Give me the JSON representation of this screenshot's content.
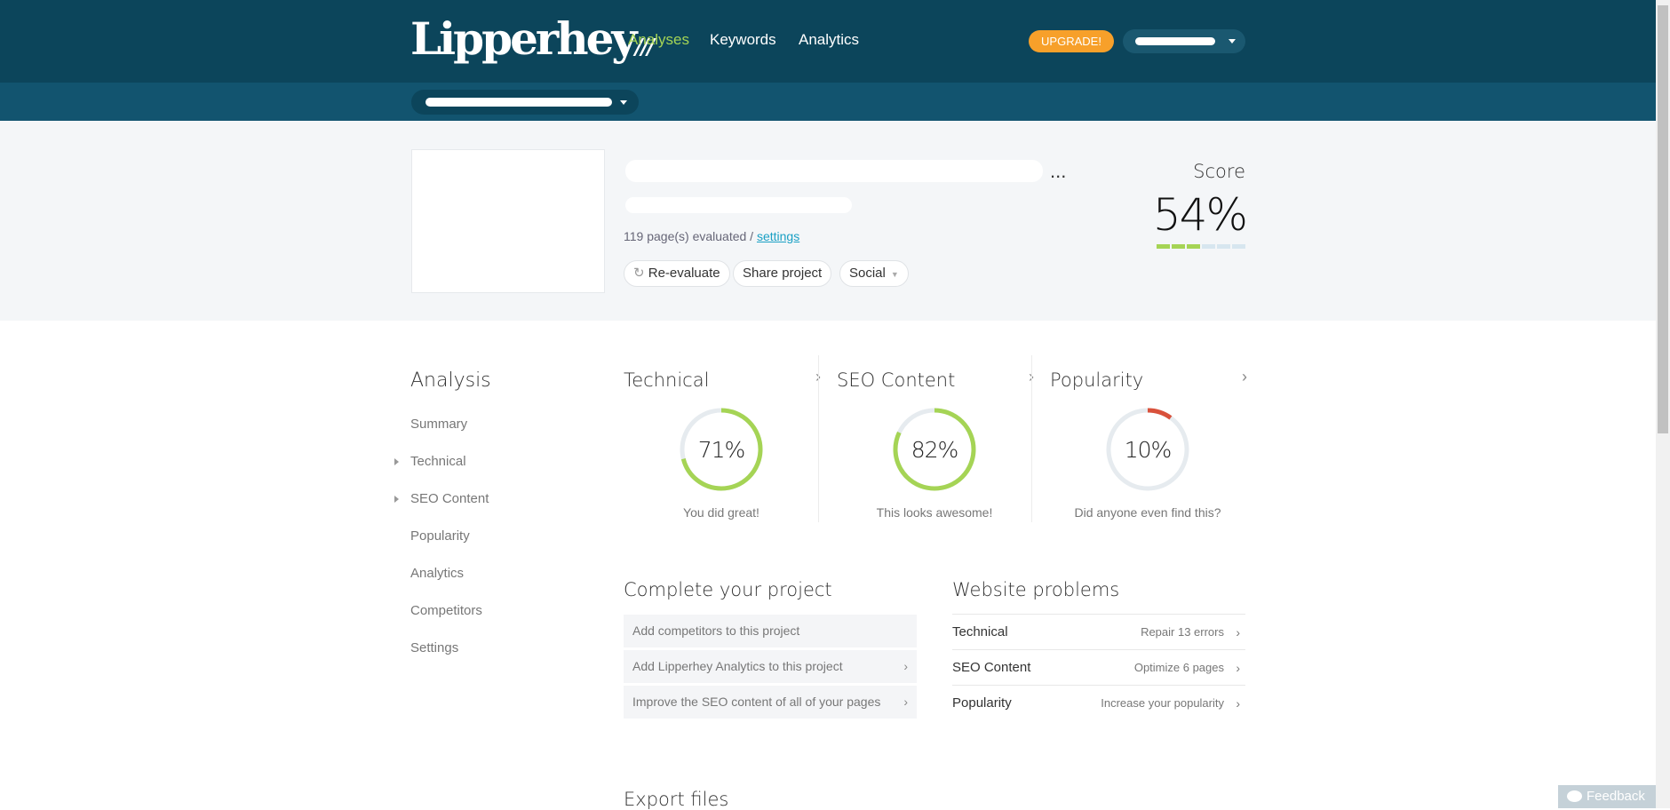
{
  "header": {
    "logo": "Lipperhey",
    "nav": [
      {
        "label": "Analyses",
        "active": true
      },
      {
        "label": "Keywords",
        "active": false
      },
      {
        "label": "Analytics",
        "active": false
      }
    ],
    "upgrade_label": "UPGRADE!"
  },
  "project": {
    "ellipsis": "...",
    "pages_evaluated": "119 page(s) evaluated / ",
    "settings_link": "settings",
    "buttons": {
      "reevaluate": "Re-evaluate",
      "share": "Share project",
      "social": "Social"
    },
    "score_label": "Score",
    "score_value": "54%",
    "score_percent": 54
  },
  "sidebar": {
    "title": "Analysis",
    "items": [
      {
        "label": "Summary",
        "expandable": false
      },
      {
        "label": "Technical",
        "expandable": true
      },
      {
        "label": "SEO Content",
        "expandable": true
      },
      {
        "label": "Popularity",
        "expandable": false
      },
      {
        "label": "Analytics",
        "expandable": false
      },
      {
        "label": "Competitors",
        "expandable": false
      },
      {
        "label": "Settings",
        "expandable": false
      }
    ]
  },
  "cards": [
    {
      "title": "Technical",
      "value": "71%",
      "percent": 71,
      "caption": "You did great!",
      "color": "#a5d455"
    },
    {
      "title": "SEO Content",
      "value": "82%",
      "percent": 82,
      "caption": "This looks awesome!",
      "color": "#a5d455"
    },
    {
      "title": "Popularity",
      "value": "10%",
      "percent": 10,
      "caption": "Did anyone even find this?",
      "color": "#d9513b"
    }
  ],
  "complete": {
    "title": "Complete your project",
    "items": [
      {
        "label": "Add competitors to this project",
        "chevron": false
      },
      {
        "label": "Add Lipperhey Analytics to this project",
        "chevron": true
      },
      {
        "label": "Improve the SEO content of all of your pages",
        "chevron": true
      }
    ]
  },
  "problems": {
    "title": "Website problems",
    "items": [
      {
        "name": "Technical",
        "action": "Repair 13 errors"
      },
      {
        "name": "SEO Content",
        "action": "Optimize 6 pages"
      },
      {
        "name": "Popularity",
        "action": "Increase your popularity"
      }
    ]
  },
  "export_title": "Export files",
  "feedback_label": "Feedback",
  "colors": {
    "header": "#0c455b",
    "subbar": "#12546f",
    "accent": "#a5d455",
    "upgrade": "#f7a02a",
    "bad": "#d9513b",
    "link": "#1aa0c4"
  }
}
